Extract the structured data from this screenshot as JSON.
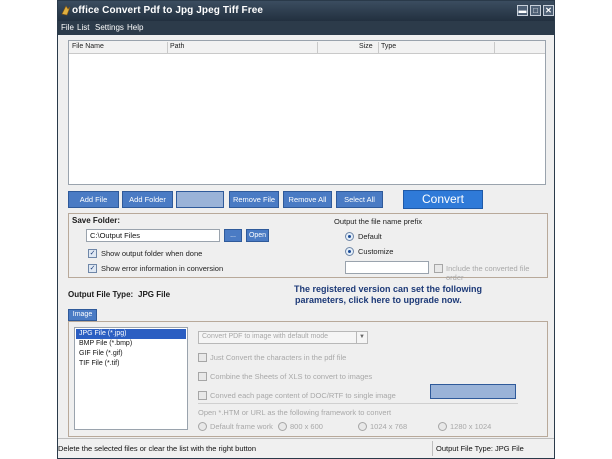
{
  "window": {
    "title": "office Convert Pdf to Jpg Jpeg Tiff Free",
    "controls": [
      "minimize",
      "maximize",
      "close"
    ]
  },
  "menu": [
    "File",
    "List",
    "Settings",
    "Help"
  ],
  "file_list": {
    "columns": [
      "File Name",
      "Path",
      "Size",
      "Type"
    ],
    "rows": []
  },
  "toolbar": {
    "add_file": "Add File",
    "add_folder": "Add Folder",
    "disabled_button": "",
    "remove_file": "Remove File",
    "remove_all": "Remove All",
    "select_all": "Select All",
    "convert": "Convert"
  },
  "save": {
    "label": "Save Folder:",
    "folder_value": "C:\\Output Files",
    "browse_label": "...",
    "open_label": "Open",
    "show_output_folder": "Show output folder when done",
    "show_error_info": "Show error information in conversion",
    "prefix_label": "Output the file name prefix",
    "default_label": "Default",
    "customize_label": "Customize",
    "customize_value": "",
    "include_order": "Include the converted file order"
  },
  "output_type": {
    "label": "Output File Type:",
    "value": "JPG File"
  },
  "upgrade": {
    "line1": "The registered version can set the following",
    "line2": "parameters, click here to upgrade now."
  },
  "image_tab": {
    "tab_label": "Image",
    "types": [
      "JPG File  (*.jpg)",
      "BMP File  (*.bmp)",
      "GIF File  (*.gif)",
      "TIF File  (*.tif)"
    ],
    "selected_index": 0,
    "mode_select": "Convert PDF to image with default mode",
    "opt_just_convert": "Just Convert the characters in the pdf file",
    "opt_combine_xls": "Combine the Sheets of XLS to convert to images",
    "opt_convert_doc": "Conved each page content of DOC/RTF to single image",
    "framework_label": "Open *.HTM or URL as the following framework to convert",
    "frameworks": [
      "Default frame work",
      "800 x 600",
      "1024 x 768",
      "1280 x 1024"
    ]
  },
  "status": {
    "left": "Delete the selected files or clear the list with the right button",
    "right": "Output File Type:  JPG File"
  },
  "colors": {
    "title_bar": "#2c3b4a",
    "button_blue": "#4a7bc4",
    "upgrade_text": "#1d3a78"
  }
}
